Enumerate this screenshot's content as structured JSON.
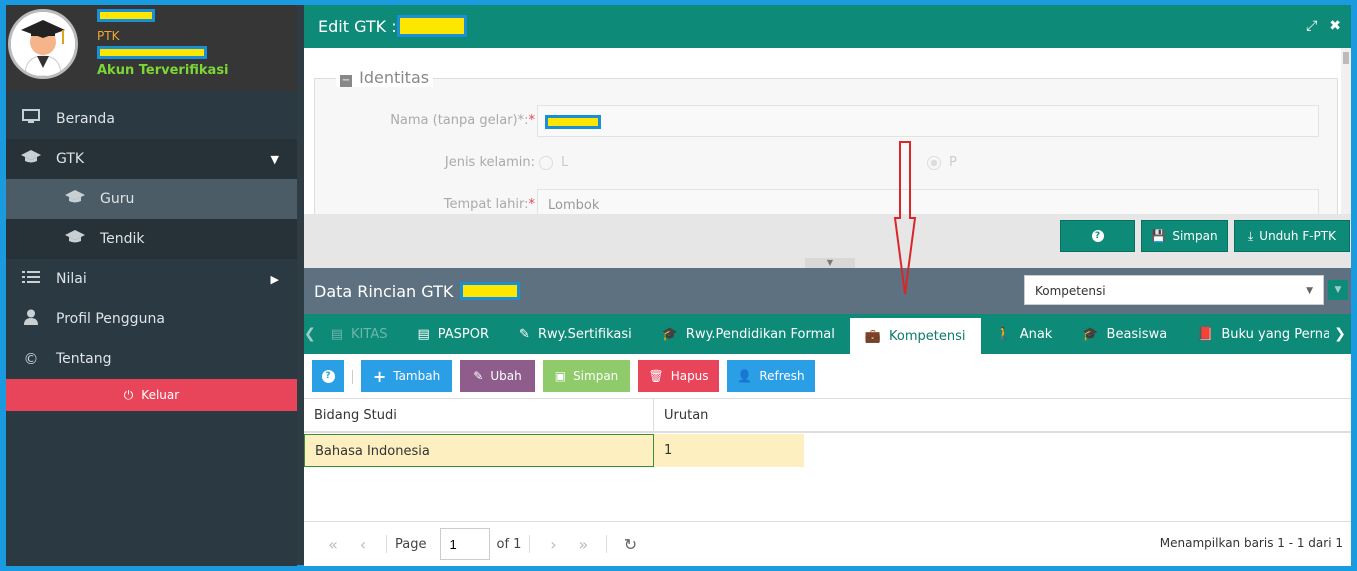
{
  "profile": {
    "role": "PTK",
    "status": "Akun Terverifikasi"
  },
  "sidebar": {
    "items": [
      {
        "label": "Beranda",
        "icon": "monitor-icon"
      },
      {
        "label": "GTK",
        "icon": "graduation-cap-icon"
      },
      {
        "label": "Guru",
        "icon": "graduation-cap-icon"
      },
      {
        "label": "Tendik",
        "icon": "graduation-cap-icon"
      },
      {
        "label": "Nilai",
        "icon": "list-icon"
      },
      {
        "label": "Profil Pengguna",
        "icon": "user-icon"
      },
      {
        "label": "Tentang",
        "icon": "copyright-icon"
      }
    ],
    "logout_label": "Keluar"
  },
  "window": {
    "title": "Edit GTK : ("
  },
  "identitas": {
    "legend": "Identitas",
    "nama_label": "Nama (tanpa gelar)*:",
    "jk_label": "Jenis kelamin:",
    "jk_l": "L",
    "jk_p": "P",
    "tempat_label": "Tempat lahir:",
    "tempat_value": "Lombok"
  },
  "toolbar": {
    "help_label": "?",
    "simpan_label": "Simpan",
    "unduh_label": "Unduh F-PTK"
  },
  "rincian": {
    "title": "Data Rincian GTK : (",
    "select_value": "Kompetensi"
  },
  "tabs": [
    {
      "label": "KITAS",
      "state": "disabled"
    },
    {
      "label": "PASPOR",
      "state": "normal"
    },
    {
      "label": "Rwy.Sertifikasi",
      "state": "normal"
    },
    {
      "label": "Rwy.Pendidikan Formal",
      "state": "normal"
    },
    {
      "label": "Kompetensi",
      "state": "active"
    },
    {
      "label": "Anak",
      "state": "normal"
    },
    {
      "label": "Beasiswa",
      "state": "normal"
    },
    {
      "label": "Buku yang Pernah Ditulis",
      "state": "normal"
    }
  ],
  "grid_toolbar": {
    "tambah": "Tambah",
    "ubah": "Ubah",
    "simpan": "Simpan",
    "hapus": "Hapus",
    "refresh": "Refresh"
  },
  "grid": {
    "columns": [
      "Bidang Studi",
      "Urutan"
    ],
    "rows": [
      [
        "Bahasa Indonesia",
        "1"
      ]
    ]
  },
  "pager": {
    "page_label": "Page",
    "page_value": "1",
    "of_label": "of 1",
    "info": "Menampilkan baris 1 - 1 dari 1"
  },
  "colors": {
    "teal": "#0d8a78",
    "sidebar": "#2b3a42",
    "logout": "#e8455a",
    "frame": "#1a9be0"
  }
}
